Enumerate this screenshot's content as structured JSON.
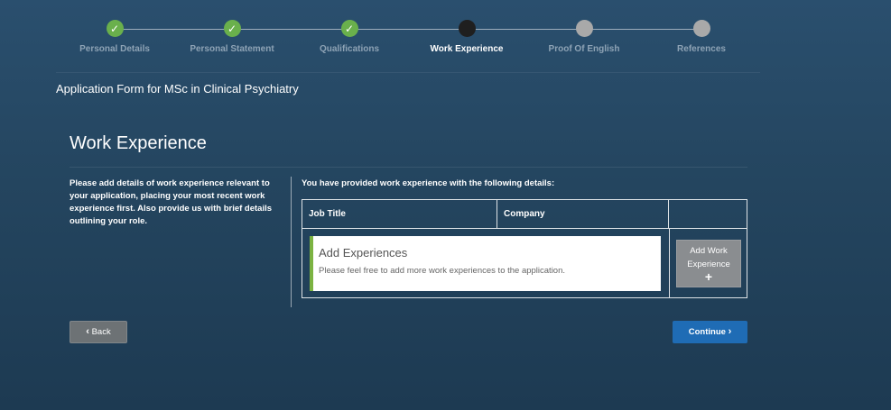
{
  "stepper": {
    "steps": [
      {
        "label": "Personal Details",
        "status": "done",
        "icon": "check-icon"
      },
      {
        "label": "Personal Statement",
        "status": "done",
        "icon": "check-icon"
      },
      {
        "label": "Qualifications",
        "status": "done",
        "icon": "check-icon"
      },
      {
        "label": "Work Experience",
        "status": "current",
        "icon": "current-step-dot"
      },
      {
        "label": "Proof Of English",
        "status": "todo",
        "icon": "pending-step-dot"
      },
      {
        "label": "References",
        "status": "todo",
        "icon": "pending-step-dot"
      }
    ],
    "check_glyph": "✓"
  },
  "form": {
    "title": "Application Form for MSc in Clinical Psychiatry"
  },
  "section": {
    "title": "Work Experience",
    "instructions": "Please add details of work experience relevant to your application, placing your most recent work experience first. Also provide us with brief details outlining your role.",
    "provided_text": "You have provided work experience with the following details:"
  },
  "table": {
    "headers": [
      "Job Title",
      "Company",
      ""
    ],
    "card_title": "Add Experiences",
    "card_text": "Please feel free to add more work experiences to the application.",
    "add_button_line1": "Add Work",
    "add_button_line2": "Experience",
    "add_button_plus": "+"
  },
  "buttons": {
    "back_label": "Back",
    "continue_label": "Continue",
    "back_icon": "‹",
    "continue_icon": "›"
  },
  "colors": {
    "done": "#6ab04c",
    "current": "#1f1f1f",
    "todo": "#a9a9a9",
    "primary": "#1f6cb5",
    "card_accent": "#7cb342"
  }
}
